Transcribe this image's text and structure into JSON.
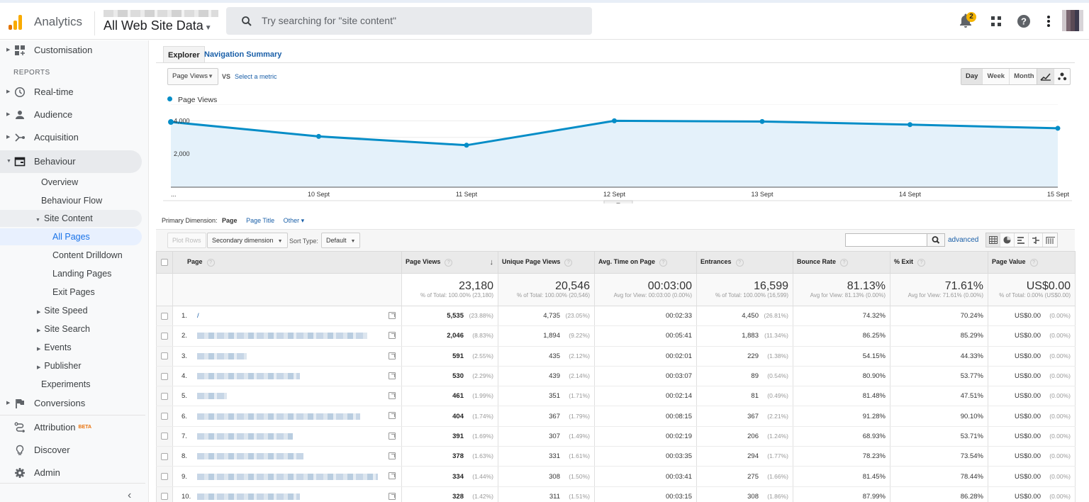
{
  "header": {
    "app_name": "Analytics",
    "view_name": "All Web Site Data",
    "search_placeholder": "Try searching for \"site content\"",
    "notification_count": "2"
  },
  "sidebar": {
    "customisation": "Customisation",
    "reports_label": "REPORTS",
    "items": [
      {
        "label": "Real-time",
        "icon": "clock-icon"
      },
      {
        "label": "Audience",
        "icon": "person-icon"
      },
      {
        "label": "Acquisition",
        "icon": "acquisition-icon"
      },
      {
        "label": "Behaviour",
        "icon": "behaviour-icon"
      }
    ],
    "behaviour_sub": [
      "Overview",
      "Behaviour Flow"
    ],
    "site_content": "Site Content",
    "site_content_sub": [
      "All Pages",
      "Content Drilldown",
      "Landing Pages",
      "Exit Pages"
    ],
    "behaviour_more": [
      "Site Speed",
      "Site Search",
      "Events",
      "Publisher"
    ],
    "experiments": "Experiments",
    "conversions": "Conversions",
    "attribution": "Attribution",
    "beta": "BETA",
    "discover": "Discover",
    "admin": "Admin"
  },
  "main": {
    "tabs": [
      "Explorer",
      "Navigation Summary"
    ],
    "metric_select": "Page Views",
    "vs": "VS",
    "select_metric": "Select a metric",
    "granularity": [
      "Day",
      "Week",
      "Month"
    ],
    "active_granularity": "Day",
    "legend": "Page Views",
    "primary_dimension_label": "Primary Dimension:",
    "primary_dimension": "Page",
    "dimension_links": [
      "Page Title",
      "Other ▾"
    ],
    "plot_rows": "Plot Rows",
    "secondary_dimension": "Secondary dimension",
    "sort_type_label": "Sort Type:",
    "sort_type": "Default",
    "advanced": "advanced"
  },
  "chart_data": {
    "type": "area",
    "title": "",
    "series": [
      {
        "name": "Page Views",
        "color": "#058dc7",
        "values": [
          3930,
          3060,
          2530,
          4000,
          3960,
          3770,
          3550
        ]
      }
    ],
    "categories": [
      "...",
      "10 Sept",
      "11 Sept",
      "12 Sept",
      "13 Sept",
      "14 Sept",
      "15 Sept"
    ],
    "y_ticks": [
      "2,000",
      "4,000"
    ],
    "ylim": [
      0,
      5000
    ],
    "xlabel": "",
    "ylabel": "",
    "grid": true,
    "legend": "top-left"
  },
  "table": {
    "columns": [
      "Page",
      "Page Views",
      "Unique Page Views",
      "Avg. Time on Page",
      "Entrances",
      "Bounce Rate",
      "% Exit",
      "Page Value"
    ],
    "sorted_column": "Page Views",
    "totals": [
      {
        "value": "23,180",
        "sub": "% of Total: 100.00% (23,180)"
      },
      {
        "value": "20,546",
        "sub": "% of Total: 100.00% (20,546)"
      },
      {
        "value": "00:03:00",
        "sub": "Avg for View: 00:03:00 (0.00%)"
      },
      {
        "value": "16,599",
        "sub": "% of Total: 100.00% (16,599)"
      },
      {
        "value": "81.13%",
        "sub": "Avg for View: 81.13% (0.00%)"
      },
      {
        "value": "71.61%",
        "sub": "Avg for View: 71.61% (0.00%)"
      },
      {
        "value": "US$0.00",
        "sub": "% of Total: 0.00% (US$0.00)"
      }
    ],
    "rows": [
      {
        "idx": "1.",
        "page": "/",
        "pv": "5,535",
        "pv_pct": "(23.88%)",
        "upv": "4,735",
        "upv_pct": "(23.05%)",
        "time": "00:02:33",
        "ent": "4,450",
        "ent_pct": "(26.81%)",
        "bounce": "74.32%",
        "exit": "70.24%",
        "value": "US$0.00",
        "value_pct": "(0.00%)"
      },
      {
        "idx": "2.",
        "page": "",
        "pv": "2,046",
        "pv_pct": "(8.83%)",
        "upv": "1,894",
        "upv_pct": "(9.22%)",
        "time": "00:05:41",
        "ent": "1,883",
        "ent_pct": "(11.34%)",
        "bounce": "86.25%",
        "exit": "85.29%",
        "value": "US$0.00",
        "value_pct": "(0.00%)"
      },
      {
        "idx": "3.",
        "page": "",
        "pv": "591",
        "pv_pct": "(2.55%)",
        "upv": "435",
        "upv_pct": "(2.12%)",
        "time": "00:02:01",
        "ent": "229",
        "ent_pct": "(1.38%)",
        "bounce": "54.15%",
        "exit": "44.33%",
        "value": "US$0.00",
        "value_pct": "(0.00%)"
      },
      {
        "idx": "4.",
        "page": "",
        "pv": "530",
        "pv_pct": "(2.29%)",
        "upv": "439",
        "upv_pct": "(2.14%)",
        "time": "00:03:07",
        "ent": "89",
        "ent_pct": "(0.54%)",
        "bounce": "80.90%",
        "exit": "53.77%",
        "value": "US$0.00",
        "value_pct": "(0.00%)"
      },
      {
        "idx": "5.",
        "page": "",
        "pv": "461",
        "pv_pct": "(1.99%)",
        "upv": "351",
        "upv_pct": "(1.71%)",
        "time": "00:02:14",
        "ent": "81",
        "ent_pct": "(0.49%)",
        "bounce": "81.48%",
        "exit": "47.51%",
        "value": "US$0.00",
        "value_pct": "(0.00%)"
      },
      {
        "idx": "6.",
        "page": "",
        "pv": "404",
        "pv_pct": "(1.74%)",
        "upv": "367",
        "upv_pct": "(1.79%)",
        "time": "00:08:15",
        "ent": "367",
        "ent_pct": "(2.21%)",
        "bounce": "91.28%",
        "exit": "90.10%",
        "value": "US$0.00",
        "value_pct": "(0.00%)"
      },
      {
        "idx": "7.",
        "page": "",
        "pv": "391",
        "pv_pct": "(1.69%)",
        "upv": "307",
        "upv_pct": "(1.49%)",
        "time": "00:02:19",
        "ent": "206",
        "ent_pct": "(1.24%)",
        "bounce": "68.93%",
        "exit": "53.71%",
        "value": "US$0.00",
        "value_pct": "(0.00%)"
      },
      {
        "idx": "8.",
        "page": "",
        "pv": "378",
        "pv_pct": "(1.63%)",
        "upv": "331",
        "upv_pct": "(1.61%)",
        "time": "00:03:35",
        "ent": "294",
        "ent_pct": "(1.77%)",
        "bounce": "78.23%",
        "exit": "73.54%",
        "value": "US$0.00",
        "value_pct": "(0.00%)"
      },
      {
        "idx": "9.",
        "page": "",
        "pv": "334",
        "pv_pct": "(1.44%)",
        "upv": "308",
        "upv_pct": "(1.50%)",
        "time": "00:03:41",
        "ent": "275",
        "ent_pct": "(1.66%)",
        "bounce": "81.45%",
        "exit": "78.44%",
        "value": "US$0.00",
        "value_pct": "(0.00%)"
      },
      {
        "idx": "10.",
        "page": "",
        "pv": "328",
        "pv_pct": "(1.42%)",
        "upv": "311",
        "upv_pct": "(1.51%)",
        "time": "00:03:15",
        "ent": "308",
        "ent_pct": "(1.86%)",
        "bounce": "87.99%",
        "exit": "86.28%",
        "value": "US$0.00",
        "value_pct": "(0.00%)"
      }
    ]
  }
}
